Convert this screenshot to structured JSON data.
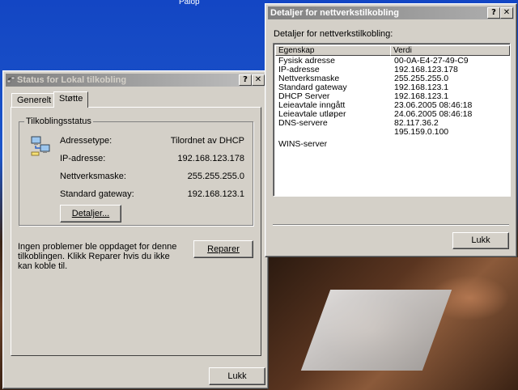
{
  "desktop": {
    "caption": "Palop"
  },
  "status_window": {
    "title": "Status for Lokal tilkobling",
    "help_button": "?",
    "close_button": "✕",
    "tabs": [
      {
        "label": "Generelt",
        "selected": false
      },
      {
        "label": "Støtte",
        "selected": true
      }
    ],
    "group_title": "Tilkoblingsstatus",
    "rows": [
      {
        "label": "Adressetype:",
        "value": "Tilordnet av DHCP"
      },
      {
        "label": "IP-adresse:",
        "value": "192.168.123.178"
      },
      {
        "label": "Nettverksmaske:",
        "value": "255.255.255.0"
      },
      {
        "label": "Standard gateway:",
        "value": "192.168.123.1"
      }
    ],
    "details_button": "Detaljer...",
    "message": "Ingen problemer ble oppdaget for denne tilkoblingen. Klikk Reparer hvis du ikke kan koble til.",
    "repair_button": "Reparer",
    "close_label": "Lukk"
  },
  "details_window": {
    "title": "Detaljer for nettverkstilkobling",
    "help_button": "?",
    "close_button": "✕",
    "subtitle": "Detaljer for nettverkstilkobling:",
    "columns": [
      "Egenskap",
      "Verdi"
    ],
    "rows": [
      {
        "property": "Fysisk adresse",
        "value": "00-0A-E4-27-49-C9"
      },
      {
        "property": "IP-adresse",
        "value": "192.168.123.178"
      },
      {
        "property": "Nettverksmaske",
        "value": "255.255.255.0"
      },
      {
        "property": "Standard gateway",
        "value": "192.168.123.1"
      },
      {
        "property": "DHCP Server",
        "value": "192.168.123.1"
      },
      {
        "property": "Leieavtale inngått",
        "value": "23.06.2005 08:46:18"
      },
      {
        "property": "Leieavtale utløper",
        "value": "24.06.2005 08:46:18"
      },
      {
        "property": "DNS-servere",
        "value": "82.117.36.2"
      },
      {
        "property": "",
        "value": "195.159.0.100"
      },
      {
        "property": "WINS-server",
        "value": ""
      }
    ],
    "close_label": "Lukk"
  }
}
